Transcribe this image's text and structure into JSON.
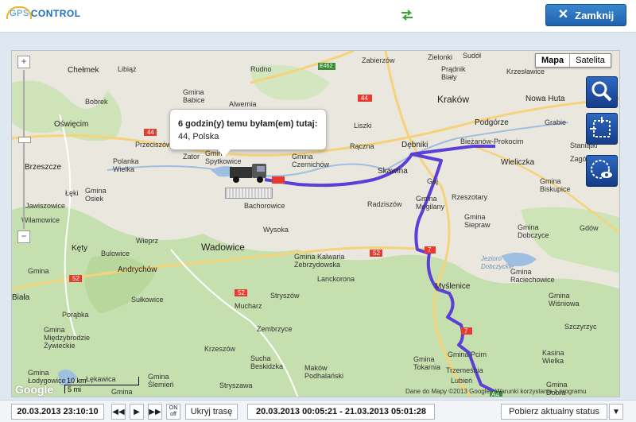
{
  "header": {
    "logo_gps": "GPS",
    "logo_control": "CONTROL",
    "close_label": "Zamknij"
  },
  "map": {
    "type_map": "Mapa",
    "type_satellite": "Satelita",
    "tooltip_line1": "6 godzin(y) temu byłam(em) tutaj:",
    "tooltip_line2": "44, Polska",
    "scale_km": "10 km",
    "scale_mi": "5 mi",
    "attribution": "Dane do Mapy ©2013 Google - Warunki korzystania z programu",
    "google": "Google",
    "route_color": "#5b3fd6",
    "places": [
      {
        "name": "Kraków",
        "cls": "city"
      },
      {
        "name": "Wadowice",
        "cls": "city"
      },
      {
        "name": "Wieliczka",
        "cls": "mid"
      },
      {
        "name": "Myślenice",
        "cls": "mid"
      },
      {
        "name": "Skawina",
        "cls": "mid"
      },
      {
        "name": "Dębniki",
        "cls": "mid"
      },
      {
        "name": "Podgórze",
        "cls": "mid"
      },
      {
        "name": "Bieżanów-Prokocim",
        "cls": "mid"
      },
      {
        "name": "Nowa Huta",
        "cls": "mid"
      },
      {
        "name": "Andrychów",
        "cls": "mid"
      },
      {
        "name": "Oświęcim",
        "cls": "mid"
      },
      {
        "name": "Chełmek",
        "cls": "mid"
      },
      {
        "name": "Kęty",
        "cls": "mid"
      },
      {
        "name": "Zator",
        "cls": ""
      },
      {
        "name": "Libiąż",
        "cls": ""
      },
      {
        "name": "Rudno",
        "cls": ""
      },
      {
        "name": "Zabierzów",
        "cls": ""
      },
      {
        "name": "Zielonki",
        "cls": ""
      },
      {
        "name": "Prądnik Biały",
        "cls": ""
      },
      {
        "name": "Sudół",
        "cls": ""
      },
      {
        "name": "Krzesławice",
        "cls": ""
      },
      {
        "name": "Bobrek",
        "cls": ""
      },
      {
        "name": "Gmina Babice",
        "cls": ""
      },
      {
        "name": "Alwernia",
        "cls": ""
      },
      {
        "name": "Gmina Spytkowice",
        "cls": ""
      },
      {
        "name": "Gmina Czernichów",
        "cls": ""
      },
      {
        "name": "Liszki",
        "cls": ""
      },
      {
        "name": "Rączna",
        "cls": ""
      },
      {
        "name": "Przeciszów",
        "cls": ""
      },
      {
        "name": "Polanka Wielka",
        "cls": ""
      },
      {
        "name": "Brzeszcze",
        "cls": ""
      },
      {
        "name": "Gmina Osiek",
        "cls": ""
      },
      {
        "name": "Łęki",
        "cls": ""
      },
      {
        "name": "Jawiszowice",
        "cls": ""
      },
      {
        "name": "Wilamowice",
        "cls": ""
      },
      {
        "name": "Bachorowice",
        "cls": ""
      },
      {
        "name": "Wysoka",
        "cls": ""
      },
      {
        "name": "Radziszów",
        "cls": ""
      },
      {
        "name": "Gmina Mogilany",
        "cls": ""
      },
      {
        "name": "Rzeszotary",
        "cls": ""
      },
      {
        "name": "Gmina Siepraw",
        "cls": ""
      },
      {
        "name": "Gmina Biskupice",
        "cls": ""
      },
      {
        "name": "Zagórze",
        "cls": ""
      },
      {
        "name": "Grabie",
        "cls": ""
      },
      {
        "name": "Staniątki",
        "cls": ""
      },
      {
        "name": "Gmina Dobczyce",
        "cls": ""
      },
      {
        "name": "Gdów",
        "cls": ""
      },
      {
        "name": "Gmina Raciechowice",
        "cls": ""
      },
      {
        "name": "Jezioro Dobczyckie",
        "cls": "water"
      },
      {
        "name": "Wieprz",
        "cls": ""
      },
      {
        "name": "Bulowice",
        "cls": ""
      },
      {
        "name": "Gmina Kalwaria Zebrzydowska",
        "cls": ""
      },
      {
        "name": "Lanckorona",
        "cls": ""
      },
      {
        "name": "Stryszów",
        "cls": ""
      },
      {
        "name": "Mucharz",
        "cls": ""
      },
      {
        "name": "Zembrzyce",
        "cls": ""
      },
      {
        "name": "Krzeszów",
        "cls": ""
      },
      {
        "name": "Sucha Beskidzka",
        "cls": ""
      },
      {
        "name": "Maków Podhalański",
        "cls": ""
      },
      {
        "name": "Stryszawa",
        "cls": ""
      },
      {
        "name": "Sułkowice",
        "cls": ""
      },
      {
        "name": "Porąbka",
        "cls": ""
      },
      {
        "name": "Gmina Międzybrodzie Żywieckie",
        "cls": ""
      },
      {
        "name": "Gmina Łodygowice",
        "cls": ""
      },
      {
        "name": "Łękawica",
        "cls": ""
      },
      {
        "name": "Gmina",
        "cls": ""
      },
      {
        "name": "Gmina Ślemień",
        "cls": ""
      },
      {
        "name": "Gmina Pcim",
        "cls": ""
      },
      {
        "name": "Gmina Tokarnia",
        "cls": ""
      },
      {
        "name": "Trzemeśnia",
        "cls": ""
      },
      {
        "name": "Lubień",
        "cls": ""
      },
      {
        "name": "Kasina Wielka",
        "cls": ""
      },
      {
        "name": "Szczyrzyc",
        "cls": ""
      },
      {
        "name": "Gmina Wiśniowa",
        "cls": ""
      },
      {
        "name": "Gmina Dobra",
        "cls": ""
      },
      {
        "name": "Gaj",
        "cls": ""
      },
      {
        "name": "Gmina",
        "cls": ""
      },
      {
        "name": "Biała",
        "cls": ""
      }
    ],
    "roads": [
      "E462",
      "44",
      "44",
      "52",
      "52",
      "52",
      "7",
      "7",
      "A4"
    ]
  },
  "bottom": {
    "time": "20.03.2013 23:10:10",
    "prev_label": "◀◀",
    "play_label": "▶",
    "next_label": "▶▶",
    "onoff_label": "ON off",
    "hide_label": "Ukryj trasę",
    "range": "20.03.2013 00:05:21 - 21.03.2013 05:01:28",
    "fetch_label": "Pobierz aktualny status",
    "dropdown_label": "▼"
  }
}
